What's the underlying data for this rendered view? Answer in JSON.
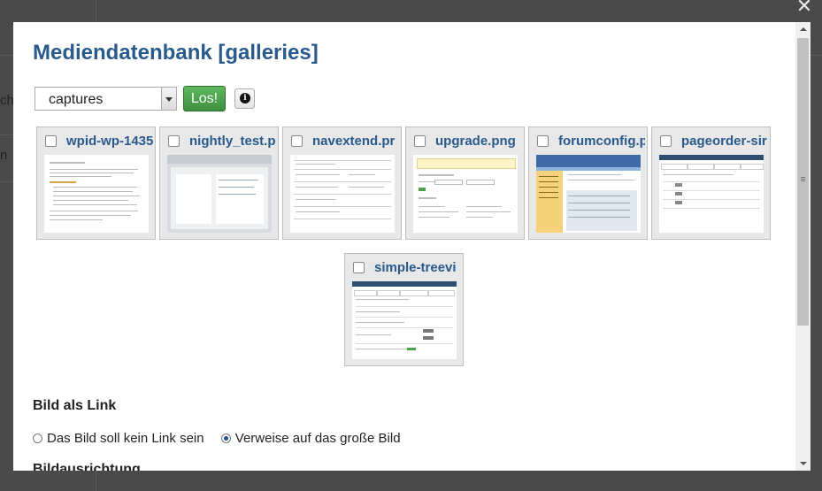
{
  "background": {
    "fragment_1": "ch",
    "fragment_2": "n"
  },
  "close": {
    "icon": "close-icon",
    "glyph": "✕"
  },
  "modal": {
    "title": "Mediendatenbank [galleries]",
    "folder_select": {
      "value": "captures"
    },
    "go_button": "Los!",
    "info_icon": {
      "icon": "info-icon",
      "glyph": "i"
    },
    "thumbnails": [
      {
        "name": "wpid-wp-1435"
      },
      {
        "name": "nightly_test.p"
      },
      {
        "name": "navextend.pr"
      },
      {
        "name": "upgrade.png"
      },
      {
        "name": "forumconfig.p"
      },
      {
        "name": "pageorder-sir"
      },
      {
        "name": "simple-treevi"
      }
    ],
    "link_section": {
      "heading": "Bild als Link",
      "options": [
        {
          "label": "Das Bild soll kein Link sein",
          "checked": false
        },
        {
          "label": "Verweise auf das große Bild",
          "checked": true
        }
      ]
    },
    "alignment_heading": "Bildausrichtung"
  }
}
